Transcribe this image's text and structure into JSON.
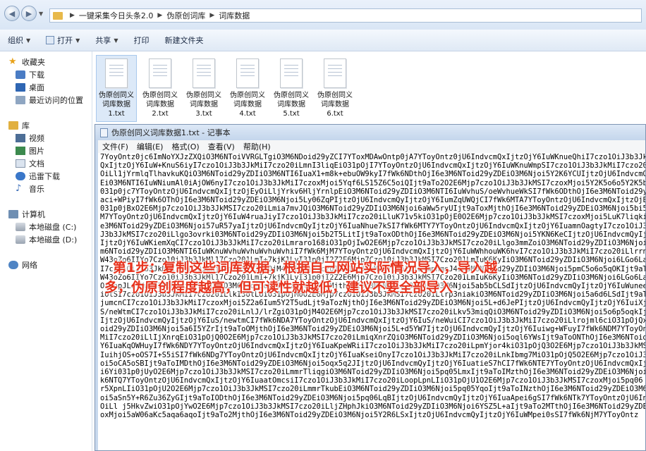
{
  "address": {
    "crumbs": [
      "一键采集今日头条2.0",
      "伪原创词库",
      "词库数据"
    ]
  },
  "toolbar": {
    "organize": "组织",
    "open": "打开",
    "share": "共享",
    "print": "打印",
    "new_folder": "新建文件夹"
  },
  "sidebar": {
    "favorites": "收藏夹",
    "downloads": "下载",
    "desktop": "桌面",
    "recent": "最近访问的位置",
    "library": "库",
    "video": "视频",
    "pictures": "图片",
    "documents": "文档",
    "thunder": "迅雷下载",
    "music": "音乐",
    "computer": "计算机",
    "disk_c": "本地磁盘 (C:)",
    "disk_d": "本地磁盘 (D:)",
    "network": "网络"
  },
  "files": [
    {
      "l1": "伪原创同义",
      "l2": "词库数据",
      "l3": "1.txt"
    },
    {
      "l1": "伪原创同义",
      "l2": "词库数据",
      "l3": "2.txt"
    },
    {
      "l1": "伪原创同义",
      "l2": "词库数据",
      "l3": "3.txt"
    },
    {
      "l1": "伪原创同义",
      "l2": "词库数据",
      "l3": "4.txt"
    },
    {
      "l1": "伪原创同义",
      "l2": "词库数据",
      "l3": "5.txt"
    },
    {
      "l1": "伪原创同义",
      "l2": "词库数据",
      "l3": "6.txt"
    }
  ],
  "notepad": {
    "title": "伪原创同义词库数据1.txt - 记事本",
    "menu": [
      "文件(F)",
      "编辑(E)",
      "格式(O)",
      "查看(V)",
      "帮助(H)"
    ],
    "lines": [
      "7YoyOntz0jc6ImNoYXJzZXQiO3M6NToiVVRGLTgiO3M6NDoid29yZCI7YToxMDAwOntp0jA7YToyOntz0jU6IndvcmQxIjtzOjY6IuWKnueQhiI7czo1OiJ3b3JkMiI7czo1",
      "QxIjtzOjY6IuW+KnuS6iyI7czo1OiJ3b3JkMiI7czo20iLmnI3liqEiO31pOjI7YToyOntzOjU6IndvcmQxIjtzOjY6IuWKnuWmpSI7czo1OiJ3b3JkMiI7czo20iLl",
      "OiLl1jYrmlqTlhavkuKQiO3M6NToid29yZDIiO3M6NTI6IuaX1+m8k+ebuOW9kyI7fWk6NDthOjI6e3M6NToid29yZDEiO3M6Njoi5Y2K6YCUIjtzOjU6IndvcmQy",
      "Ei03M6NTI6IuWNiumAl0iAjOW6nyI7czo1OiJ3b3JkMiI7czoxMjoi5Yqf6LS15Z6C5oiQIjt9aTo2O2E6Mjp7czo1OiJ3b3JkMSI7czoxMjoi5Y2K5o6o5Y2K5bCx",
      "031p0jc7YToyOntzOjU6IndvcmQxIjtzOjEyOiLljYrkv6HljYrnlpEiO3M6NToid29yZDIiO3M6NTI6IuWvhuS/oeWvhueWkSI7fWk6ODthOjI6e3M6NToid29y",
      "aci+WPiyI7fWk6OThOjI6e3M6NToid29yZDEiO3M6Njoi5Ly06ZqPIjtzOjU6IndvcmQyIjtzOjY6IumZqUWQjCI7fWk6MTA7YToyOntzOjU6IndvcmQxIjtzOjEy",
      "031p0jBxO2E6Mjp7czo1OiJ3b3JkMSI7czo20iLmia7mvJQiO3M6NToid29yZDIiO3M6Njoi6aWw5ryUIjt9aToxMjthOjI6e3M6NToid29yZDEiO3M6Njoi5bi5",
      "M7YToyOntzOjU6IndvcmQxIjtzOjY6IuW4ruaJiyI7czo1OiJ3b3JkMiI7czo20iLluK71v5kiO31pOjE0O2E6Mjp7czo1OiJ3b3JkMSI7czoxMjoi5LuK7liqkiO3",
      "e3M6NToid29yZDEiO3M6Njoi57uR57yaIjtzOjU6IndvcmQyIjtzOjY6IuaNhue7kSI7fWk6MTY7YToyOntzOjU6IndvcmQxIjtzOjY6IuamnOagtyI7czo1OiJ3",
      "J3b3JkMSI7czo20iLlgo3ovrki03M6NToid29yZDIiO3M6Njoi5b2T5LitIjt9aToxODthOjI6e3M6NToid29yZDEiO3M6Njoi5YKN6KeCIjtzOjU6IndvcmQyIjtz",
      "IjtzOjY6IuWKiemXqCI7czo1OiJ3b3JkMiI7czo20iLmraro168iO31pOjIwO2E6Mjp7czo1OiJ3b3JkMSI7czo20iLlgo3mmZoiO3M6NToid29yZDIiO3M6Njoi",
      "m6NToid29yZDIiO3M6NTI6IuWKnuWvhuWvhuWvhuWvhiI7fWk6MjM7YToyOntzOjU6IndvcmQxIjtzOjY6IuWWhhouWK6hvI7czo1OiJ3b3JkMiI7czo20iLlrrnpm",
      "W43oZo6IIYo7Czo10iJ3b3JkMl17Czo201LmI+7kjK1LyI31p0jI2Z2E6Mjp7Czo10iJ3b3JkMSI7Czo201LmIuK6KyIiO3M6NToid29yZDIiO3M6Njoi6LGo6Laj",
      "I7czo1OiJ3b3JkMiI7czo20iLnjKPmlaSIO31pOjM4O2E6Mjp7czo1OiJ3b3JkMSI7czo20iLlmpnmsJ4iO3M6NToid29yZDIiO3M6Njoi5pmC5o6o5qOKIjt9aTo",
      "W43oZo6IIYo7Czo10iJ3b3JkMl17Czo201LmI+7kjK1LyI31p0jI2Z2E6Mjp7Czo10iJ3b3JkMSI7Czo201LmIuK6KyIiO3M6NToid29yZDIiO3M6Njoi6LGo6Laj",
      "OiLopJLotKwiO3M6NToid29yZDIiO3M6Njoi5om56amzIjt9aTozMjthOjI6e3M6NToid29yZDEiO3M6Njoi5ab5bCLSdIjtzOjU6IndvcmQyIjtzOjY6IuWuneeJuSI7",
      "iOtSI7czo1OiJ3b3JkMiI7czo20iLlkI3otLUiO31pOjM0O2E6Mjp7czo1OiJ3b3JkMSI7czo20iLlrp3niakiO3M6NToid29yZDIiO3M6Njoi5a6d6LSdIjt9aTo",
      "jumcnCI7czo1OiJ3b3JkMiI7czoxMjoi5Z2a6Ium5Y2T5udLjt9aTozNjthOjI6e3M6NToid29yZDEiO3M6Njoi5L+d6JePIjtzOjU6IndvcmQyIjtzOjY6IuiXjI",
      "S/neWtmCI7czo1OiJ3b3JkMiI7czo20iLnlJ/lrZgiO31pOjM4O2E6Mjp7czo1OiJ3b3JkMSI7czo20iLkv53miqQiO3M6NToid29yZDIiO3M6Njoi5o6p5oqkIjt9",
      "IjtzOjU6IndvcmQyIjtzOjY6IuS/newtmCI7fWk6NDA7YToyOntzOjU6IndvcmQxIjtzOjY6IuS/neWuiCI7czo1OiJ3b3JkMiI7czo20iLlrojml6ciO31pOjQx",
      "oid29yZDIiO3M6Njoi5a6I5YZrIjt9aToOMjthOjI6e3M6NToid29yZDEiO3M6Njoi5L+d5YW7IjtzOjU6IndvcmQyIjtzOjY6Iuiwg+WFuyI7fWk6NDM7YToyOntz",
      "MiI7czo20iLlIjXnrqEiO31pOjQ0O2E6Mjp7czo1OiJ3b3JkMSI7czo20iLmiqXnrZQiO3M6NToid29yZDIiO3M6Njoi5oql6YWsIjt9aToONThOjI6e3M6NToid29y",
      "Y6IuaKqOWHuyI7fWk6NDY7YToyOntzOjU6IndvcmQxIjtzOjY6IuaKpeWRiiI7czo1OiJ3b3JkMiI7czo20iLpmYjor4kiO31pOjQ3O2E6Mjp7czo1OiJ3b3JkMSI7",
      "IuihjOS+oOS7I+S5iSI7fWk6NDg7YToyOntzOjU6IndvcmQxIjtzOjY6IuaKseiOnyI7czo1OiJ3b3JkMiI7czo20iLnkIbmg7MiO31pOjQ5O2E6Mjp7czo1OiJ3",
      "oi5oCA5oSBIjt9aToIMDthOjI6e3M6NToid29yZDEiO3M6Njoi5oqx5q2JIjtzOjU6IndvcmQyIjtzOjY6IuatieS7hCI7fWk6NTE7YToyOntzOjU6IndvcmQxIjtz",
      "i6Yi031p0jUyO2E6Mjp7czo1OiJ3b3JkMSI7czo20iLmmrTliqgiO3M6NToid29yZDIiO3M6Njoi5pq05LmxIjt9aToIMzthOjI6e3M6NToid29yZDEiO3M6Njoi",
      "k6NTQ7YToyOntzOjU6IndvcmQxIjtzOjY6IuaatOmcsiI7czo1OiJ3b3JkMiI7czo20iLoopLpnLIiO31pOjU1O2E6Mjp7czo1OiJ3b3JkMSI7czoxMjoi5pq06",
      "r5XpnLIiO31pOjU2O2E6Mjp7czo1OiJ3b3JkMSI7czo20iLmmrTkubEiO3M6NToid29yZDIiO3M6Njoi5pq05YqoIjt9aToINzthOjI6e3M6NToid29yZDEiO3M6",
      "oi5aSn5Y+R6Zu36ZyGIjt9aToIODthOjI6e3M6NToid29yZDEiO3M6Njoi5pq06LqBIjtzOjU6IndvcmQyIjtzOjY6IuaApei6gSI7fWk6NTk7YToyOntzOjU6Ind",
      "OiLl j5HkvZwiO31pOjYwO2E6Mjp7czo1OiJ3b3JkMSI7czo20iLljZHphJkiO3M6NToid29yZDIiO3M6Njoi6YSZ5L+aIjt9aTo2MTthOjI6e3M6NToid29yZDEi",
      "oxMjoi5aW06aKc5aqa6aqoIjt9aTo2MjthOjI6e3M6NToid29yZDEiO3M6Njoi5Y2R6LSxIjtzOjU6IndvcmQyIjtzOjY6IuWMpei0sSI7fWk6NjM7YToyOntz"
    ]
  },
  "overlay": {
    "line1_prefix": "第",
    "line1_num": "1",
    "line1_rest": "步：复制这些词库数据，根据自己网站实际情况导入，导入越",
    "line2": "多，伪原创程度越高，但可读性就越低，建议不要全部导入"
  },
  "colors": {
    "overlay_text": "#e8321c",
    "folder": "#e8b94a"
  }
}
